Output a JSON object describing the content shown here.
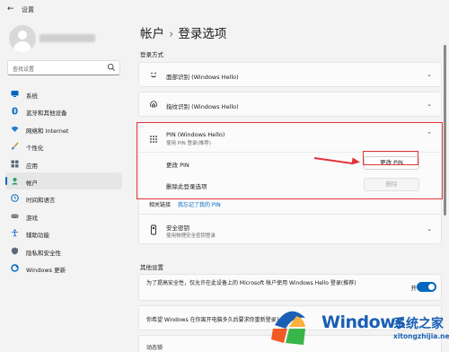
{
  "window": {
    "title": "设置",
    "back_icon": "back-arrow-icon"
  },
  "sidebar": {
    "search_placeholder": "查找设置",
    "items": [
      {
        "label": "系统",
        "icon": "monitor-icon",
        "color": "#0067c0",
        "active": false
      },
      {
        "label": "蓝牙和其他设备",
        "icon": "bluetooth-icon",
        "color": "#0067c0",
        "active": false
      },
      {
        "label": "网络和 Internet",
        "icon": "wifi-icon",
        "color": "#2b7bd0",
        "active": false
      },
      {
        "label": "个性化",
        "icon": "brush-icon",
        "color": "#c98a26",
        "active": false
      },
      {
        "label": "应用",
        "icon": "apps-icon",
        "color": "#5a6b7b",
        "active": false
      },
      {
        "label": "帐户",
        "icon": "account-icon",
        "color": "#2a9d6a",
        "active": true
      },
      {
        "label": "时间和语言",
        "icon": "clock-globe-icon",
        "color": "#0067c0",
        "active": false
      },
      {
        "label": "游戏",
        "icon": "gamepad-icon",
        "color": "#6b6b6b",
        "active": false
      },
      {
        "label": "辅助功能",
        "icon": "accessibility-icon",
        "color": "#2b7bd0",
        "active": false
      },
      {
        "label": "隐私和安全性",
        "icon": "shield-icon",
        "color": "#5a6b7b",
        "active": false
      },
      {
        "label": "Windows 更新",
        "icon": "update-icon",
        "color": "#0067c0",
        "active": false
      }
    ]
  },
  "main": {
    "breadcrumb": [
      "帐户",
      "登录选项"
    ],
    "sign_in_section_label": "登录方式",
    "face": {
      "title": "面部识别 (Windows Hello)"
    },
    "fingerprint": {
      "title": "指纹识别 (Windows Hello)"
    },
    "pin": {
      "title": "PIN (Windows Hello)",
      "subtitle": "使用 PIN 登录(推荐)",
      "change_label": "更改 PIN",
      "change_button": "更改 PIN",
      "remove_label": "删除此登录选项",
      "remove_button": "删除"
    },
    "related": {
      "label": "相关链接",
      "link": "我忘记了我的 PIN"
    },
    "security_key": {
      "title": "安全密钥",
      "subtitle": "使用物理安全密钥登录"
    },
    "other_section_label": "其他设置",
    "other_settings": [
      {
        "text": "为了提高安全性，仅允许在此设备上的 Microsoft 帐户使用 Windows Hello 登录(推荐)",
        "toggle_label": "开",
        "toggle_on": true
      },
      {
        "text": "你希望 Windows 在你离开电脑多久后要求你重新登录?"
      },
      {
        "text": "动态锁"
      }
    ]
  },
  "watermark": {
    "brand": "Windows",
    "cn": "系统之家",
    "url": "xitongzhijia.net"
  },
  "colors": {
    "accent": "#0067c0",
    "annotation_red": "#e0343a"
  }
}
